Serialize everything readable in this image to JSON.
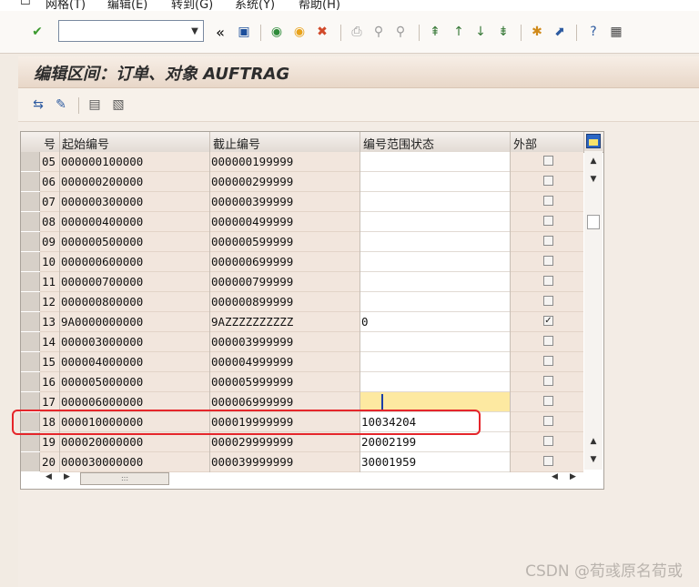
{
  "menu": [
    "网格(T)",
    "编辑(E)",
    "转到(G)",
    "系统(Y)",
    "帮助(H)"
  ],
  "toolbar": {
    "command_value": ""
  },
  "title": "编辑区间：订单、对象 AUFTRAG",
  "table": {
    "headers": [
      "号",
      "起始编号",
      "截止编号",
      "编号范围状态",
      "外部"
    ],
    "rows": [
      {
        "no": "05",
        "from": "000000100000",
        "to": "000000199999",
        "status": "",
        "ext": false
      },
      {
        "no": "06",
        "from": "000000200000",
        "to": "000000299999",
        "status": "",
        "ext": false
      },
      {
        "no": "07",
        "from": "000000300000",
        "to": "000000399999",
        "status": "",
        "ext": false
      },
      {
        "no": "08",
        "from": "000000400000",
        "to": "000000499999",
        "status": "",
        "ext": false
      },
      {
        "no": "09",
        "from": "000000500000",
        "to": "000000599999",
        "status": "",
        "ext": false
      },
      {
        "no": "10",
        "from": "000000600000",
        "to": "000000699999",
        "status": "",
        "ext": false
      },
      {
        "no": "11",
        "from": "000000700000",
        "to": "000000799999",
        "status": "",
        "ext": false
      },
      {
        "no": "12",
        "from": "000000800000",
        "to": "000000899999",
        "status": "",
        "ext": false
      },
      {
        "no": "13",
        "from": "9A0000000000",
        "to": "9AZZZZZZZZZZ",
        "status": "0",
        "ext": true
      },
      {
        "no": "14",
        "from": "000003000000",
        "to": "000003999999",
        "status": "",
        "ext": false
      },
      {
        "no": "15",
        "from": "000004000000",
        "to": "000004999999",
        "status": "",
        "ext": false
      },
      {
        "no": "16",
        "from": "000005000000",
        "to": "000005999999",
        "status": "",
        "ext": false
      },
      {
        "no": "17",
        "from": "000006000000",
        "to": "000006999999",
        "status": "",
        "ext": false
      },
      {
        "no": "18",
        "from": "000010000000",
        "to": "000019999999",
        "status": "10034204",
        "ext": false
      },
      {
        "no": "19",
        "from": "000020000000",
        "to": "000029999999",
        "status": "20002199",
        "ext": false
      },
      {
        "no": "20",
        "from": "000030000000",
        "to": "000039999999",
        "status": "30001959",
        "ext": false
      }
    ]
  },
  "scroll_thumb_grip": ":::",
  "watermark": "CSDN @荀彧原名荀或",
  "colors": {
    "highlight": "#e5262b",
    "active_cell": "#fde9a1"
  }
}
